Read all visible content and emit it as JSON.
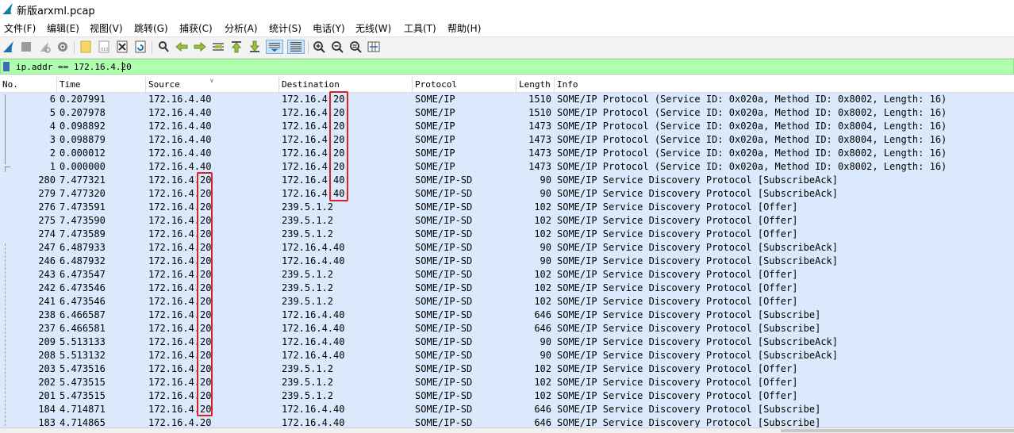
{
  "window": {
    "title": "新版arxml.pcap"
  },
  "menu": [
    "文件(F)",
    "编辑(E)",
    "视图(V)",
    "跳转(G)",
    "捕获(C)",
    "分析(A)",
    "统计(S)",
    "电话(Y)",
    "无线(W)",
    "工具(T)",
    "帮助(H)"
  ],
  "toolbar": {
    "icons": [
      "shark-fin-start-icon",
      "stop-icon",
      "restart-icon",
      "capture-options-icon",
      "open-file-icon",
      "save-file-icon",
      "close-file-icon",
      "reload-icon",
      "find-icon",
      "go-back-icon",
      "go-forward-icon",
      "go-to-packet-icon",
      "first-packet-icon",
      "last-packet-icon",
      "autoscroll-icon",
      "colorize-icon",
      "zoom-in-icon",
      "zoom-out-icon",
      "zoom-reset-icon",
      "resize-columns-icon"
    ]
  },
  "filter": {
    "value": "ip.addr == 172.16.4.20"
  },
  "columns": {
    "no": "No.",
    "time": "Time",
    "source": "Source",
    "destination": "Destination",
    "protocol": "Protocol",
    "length": "Length",
    "info": "Info"
  },
  "packets": [
    {
      "no": "6",
      "time": "0.207991",
      "src": "172.16.4.40",
      "dst": "172.16.4.20",
      "proto": "SOME/IP",
      "len": "1510",
      "info": "SOME/IP Protocol (Service ID: 0x020a, Method ID: 0x8002, Length: 16)"
    },
    {
      "no": "5",
      "time": "0.207978",
      "src": "172.16.4.40",
      "dst": "172.16.4.20",
      "proto": "SOME/IP",
      "len": "1510",
      "info": "SOME/IP Protocol (Service ID: 0x020a, Method ID: 0x8002, Length: 16)"
    },
    {
      "no": "4",
      "time": "0.098892",
      "src": "172.16.4.40",
      "dst": "172.16.4.20",
      "proto": "SOME/IP",
      "len": "1473",
      "info": "SOME/IP Protocol (Service ID: 0x020a, Method ID: 0x8004, Length: 16)"
    },
    {
      "no": "3",
      "time": "0.098879",
      "src": "172.16.4.40",
      "dst": "172.16.4.20",
      "proto": "SOME/IP",
      "len": "1473",
      "info": "SOME/IP Protocol (Service ID: 0x020a, Method ID: 0x8004, Length: 16)"
    },
    {
      "no": "2",
      "time": "0.000012",
      "src": "172.16.4.40",
      "dst": "172.16.4.20",
      "proto": "SOME/IP",
      "len": "1473",
      "info": "SOME/IP Protocol (Service ID: 0x020a, Method ID: 0x8002, Length: 16)"
    },
    {
      "no": "1",
      "time": "0.000000",
      "src": "172.16.4.40",
      "dst": "172.16.4.20",
      "proto": "SOME/IP",
      "len": "1473",
      "info": "SOME/IP Protocol (Service ID: 0x020a, Method ID: 0x8002, Length: 16)"
    },
    {
      "no": "280",
      "time": "7.477321",
      "src": "172.16.4.20",
      "dst": "172.16.4.40",
      "proto": "SOME/IP-SD",
      "len": "90",
      "info": "SOME/IP Service Discovery Protocol [SubscribeAck]"
    },
    {
      "no": "279",
      "time": "7.477320",
      "src": "172.16.4.20",
      "dst": "172.16.4.40",
      "proto": "SOME/IP-SD",
      "len": "90",
      "info": "SOME/IP Service Discovery Protocol [SubscribeAck]"
    },
    {
      "no": "276",
      "time": "7.473591",
      "src": "172.16.4.20",
      "dst": "239.5.1.2",
      "proto": "SOME/IP-SD",
      "len": "102",
      "info": "SOME/IP Service Discovery Protocol [Offer]"
    },
    {
      "no": "275",
      "time": "7.473590",
      "src": "172.16.4.20",
      "dst": "239.5.1.2",
      "proto": "SOME/IP-SD",
      "len": "102",
      "info": "SOME/IP Service Discovery Protocol [Offer]"
    },
    {
      "no": "274",
      "time": "7.473589",
      "src": "172.16.4.20",
      "dst": "239.5.1.2",
      "proto": "SOME/IP-SD",
      "len": "102",
      "info": "SOME/IP Service Discovery Protocol [Offer]"
    },
    {
      "no": "247",
      "time": "6.487933",
      "src": "172.16.4.20",
      "dst": "172.16.4.40",
      "proto": "SOME/IP-SD",
      "len": "90",
      "info": "SOME/IP Service Discovery Protocol [SubscribeAck]"
    },
    {
      "no": "246",
      "time": "6.487932",
      "src": "172.16.4.20",
      "dst": "172.16.4.40",
      "proto": "SOME/IP-SD",
      "len": "90",
      "info": "SOME/IP Service Discovery Protocol [SubscribeAck]"
    },
    {
      "no": "243",
      "time": "6.473547",
      "src": "172.16.4.20",
      "dst": "239.5.1.2",
      "proto": "SOME/IP-SD",
      "len": "102",
      "info": "SOME/IP Service Discovery Protocol [Offer]"
    },
    {
      "no": "242",
      "time": "6.473546",
      "src": "172.16.4.20",
      "dst": "239.5.1.2",
      "proto": "SOME/IP-SD",
      "len": "102",
      "info": "SOME/IP Service Discovery Protocol [Offer]"
    },
    {
      "no": "241",
      "time": "6.473546",
      "src": "172.16.4.20",
      "dst": "239.5.1.2",
      "proto": "SOME/IP-SD",
      "len": "102",
      "info": "SOME/IP Service Discovery Protocol [Offer]"
    },
    {
      "no": "238",
      "time": "6.466587",
      "src": "172.16.4.20",
      "dst": "172.16.4.40",
      "proto": "SOME/IP-SD",
      "len": "646",
      "info": "SOME/IP Service Discovery Protocol [Subscribe]"
    },
    {
      "no": "237",
      "time": "6.466581",
      "src": "172.16.4.20",
      "dst": "172.16.4.40",
      "proto": "SOME/IP-SD",
      "len": "646",
      "info": "SOME/IP Service Discovery Protocol [Subscribe]"
    },
    {
      "no": "209",
      "time": "5.513133",
      "src": "172.16.4.20",
      "dst": "172.16.4.40",
      "proto": "SOME/IP-SD",
      "len": "90",
      "info": "SOME/IP Service Discovery Protocol [SubscribeAck]"
    },
    {
      "no": "208",
      "time": "5.513132",
      "src": "172.16.4.20",
      "dst": "172.16.4.40",
      "proto": "SOME/IP-SD",
      "len": "90",
      "info": "SOME/IP Service Discovery Protocol [SubscribeAck]"
    },
    {
      "no": "203",
      "time": "5.473516",
      "src": "172.16.4.20",
      "dst": "239.5.1.2",
      "proto": "SOME/IP-SD",
      "len": "102",
      "info": "SOME/IP Service Discovery Protocol [Offer]"
    },
    {
      "no": "202",
      "time": "5.473515",
      "src": "172.16.4.20",
      "dst": "239.5.1.2",
      "proto": "SOME/IP-SD",
      "len": "102",
      "info": "SOME/IP Service Discovery Protocol [Offer]"
    },
    {
      "no": "201",
      "time": "5.473515",
      "src": "172.16.4.20",
      "dst": "239.5.1.2",
      "proto": "SOME/IP-SD",
      "len": "102",
      "info": "SOME/IP Service Discovery Protocol [Offer]"
    },
    {
      "no": "184",
      "time": "4.714871",
      "src": "172.16.4.20",
      "dst": "172.16.4.40",
      "proto": "SOME/IP-SD",
      "len": "646",
      "info": "SOME/IP Service Discovery Protocol [Subscribe]"
    },
    {
      "no": "183",
      "time": "4.714865",
      "src": "172.16.4.20",
      "dst": "172.16.4.40",
      "proto": "SOME/IP-SD",
      "len": "646",
      "info": "SOME/IP Service Discovery Protocol [Subscribe]"
    }
  ],
  "colors": {
    "row_bg": "#dae9fb",
    "filter_ok": "#afffaf",
    "highlight_box": "#e02020"
  }
}
